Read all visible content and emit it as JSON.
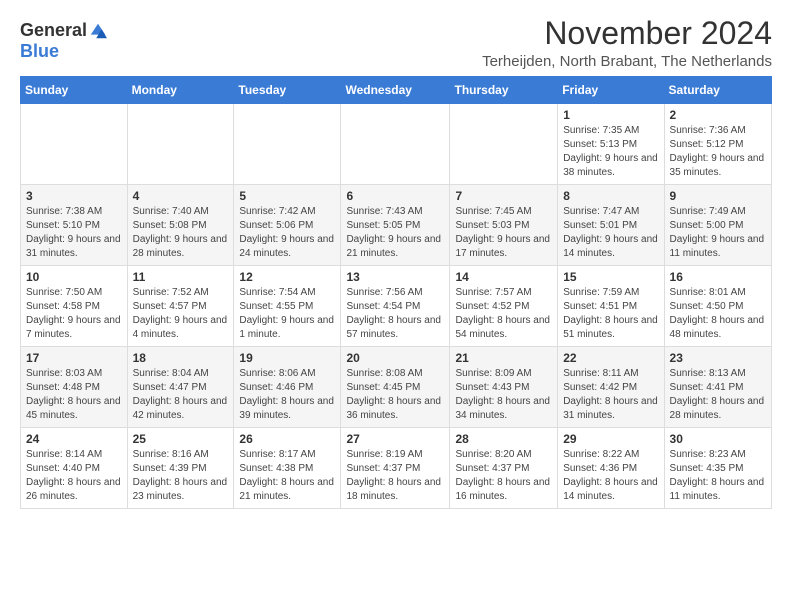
{
  "header": {
    "logo_general": "General",
    "logo_blue": "Blue",
    "month_title": "November 2024",
    "location": "Terheijden, North Brabant, The Netherlands"
  },
  "weekdays": [
    "Sunday",
    "Monday",
    "Tuesday",
    "Wednesday",
    "Thursday",
    "Friday",
    "Saturday"
  ],
  "weeks": [
    [
      {
        "day": "",
        "info": ""
      },
      {
        "day": "",
        "info": ""
      },
      {
        "day": "",
        "info": ""
      },
      {
        "day": "",
        "info": ""
      },
      {
        "day": "",
        "info": ""
      },
      {
        "day": "1",
        "info": "Sunrise: 7:35 AM\nSunset: 5:13 PM\nDaylight: 9 hours and 38 minutes."
      },
      {
        "day": "2",
        "info": "Sunrise: 7:36 AM\nSunset: 5:12 PM\nDaylight: 9 hours and 35 minutes."
      }
    ],
    [
      {
        "day": "3",
        "info": "Sunrise: 7:38 AM\nSunset: 5:10 PM\nDaylight: 9 hours and 31 minutes."
      },
      {
        "day": "4",
        "info": "Sunrise: 7:40 AM\nSunset: 5:08 PM\nDaylight: 9 hours and 28 minutes."
      },
      {
        "day": "5",
        "info": "Sunrise: 7:42 AM\nSunset: 5:06 PM\nDaylight: 9 hours and 24 minutes."
      },
      {
        "day": "6",
        "info": "Sunrise: 7:43 AM\nSunset: 5:05 PM\nDaylight: 9 hours and 21 minutes."
      },
      {
        "day": "7",
        "info": "Sunrise: 7:45 AM\nSunset: 5:03 PM\nDaylight: 9 hours and 17 minutes."
      },
      {
        "day": "8",
        "info": "Sunrise: 7:47 AM\nSunset: 5:01 PM\nDaylight: 9 hours and 14 minutes."
      },
      {
        "day": "9",
        "info": "Sunrise: 7:49 AM\nSunset: 5:00 PM\nDaylight: 9 hours and 11 minutes."
      }
    ],
    [
      {
        "day": "10",
        "info": "Sunrise: 7:50 AM\nSunset: 4:58 PM\nDaylight: 9 hours and 7 minutes."
      },
      {
        "day": "11",
        "info": "Sunrise: 7:52 AM\nSunset: 4:57 PM\nDaylight: 9 hours and 4 minutes."
      },
      {
        "day": "12",
        "info": "Sunrise: 7:54 AM\nSunset: 4:55 PM\nDaylight: 9 hours and 1 minute."
      },
      {
        "day": "13",
        "info": "Sunrise: 7:56 AM\nSunset: 4:54 PM\nDaylight: 8 hours and 57 minutes."
      },
      {
        "day": "14",
        "info": "Sunrise: 7:57 AM\nSunset: 4:52 PM\nDaylight: 8 hours and 54 minutes."
      },
      {
        "day": "15",
        "info": "Sunrise: 7:59 AM\nSunset: 4:51 PM\nDaylight: 8 hours and 51 minutes."
      },
      {
        "day": "16",
        "info": "Sunrise: 8:01 AM\nSunset: 4:50 PM\nDaylight: 8 hours and 48 minutes."
      }
    ],
    [
      {
        "day": "17",
        "info": "Sunrise: 8:03 AM\nSunset: 4:48 PM\nDaylight: 8 hours and 45 minutes."
      },
      {
        "day": "18",
        "info": "Sunrise: 8:04 AM\nSunset: 4:47 PM\nDaylight: 8 hours and 42 minutes."
      },
      {
        "day": "19",
        "info": "Sunrise: 8:06 AM\nSunset: 4:46 PM\nDaylight: 8 hours and 39 minutes."
      },
      {
        "day": "20",
        "info": "Sunrise: 8:08 AM\nSunset: 4:45 PM\nDaylight: 8 hours and 36 minutes."
      },
      {
        "day": "21",
        "info": "Sunrise: 8:09 AM\nSunset: 4:43 PM\nDaylight: 8 hours and 34 minutes."
      },
      {
        "day": "22",
        "info": "Sunrise: 8:11 AM\nSunset: 4:42 PM\nDaylight: 8 hours and 31 minutes."
      },
      {
        "day": "23",
        "info": "Sunrise: 8:13 AM\nSunset: 4:41 PM\nDaylight: 8 hours and 28 minutes."
      }
    ],
    [
      {
        "day": "24",
        "info": "Sunrise: 8:14 AM\nSunset: 4:40 PM\nDaylight: 8 hours and 26 minutes."
      },
      {
        "day": "25",
        "info": "Sunrise: 8:16 AM\nSunset: 4:39 PM\nDaylight: 8 hours and 23 minutes."
      },
      {
        "day": "26",
        "info": "Sunrise: 8:17 AM\nSunset: 4:38 PM\nDaylight: 8 hours and 21 minutes."
      },
      {
        "day": "27",
        "info": "Sunrise: 8:19 AM\nSunset: 4:37 PM\nDaylight: 8 hours and 18 minutes."
      },
      {
        "day": "28",
        "info": "Sunrise: 8:20 AM\nSunset: 4:37 PM\nDaylight: 8 hours and 16 minutes."
      },
      {
        "day": "29",
        "info": "Sunrise: 8:22 AM\nSunset: 4:36 PM\nDaylight: 8 hours and 14 minutes."
      },
      {
        "day": "30",
        "info": "Sunrise: 8:23 AM\nSunset: 4:35 PM\nDaylight: 8 hours and 11 minutes."
      }
    ]
  ]
}
